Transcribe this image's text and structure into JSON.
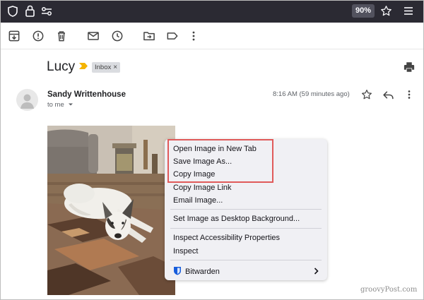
{
  "browser": {
    "zoom": "90%",
    "icons": [
      "shield-icon",
      "lock-icon",
      "permissions-icon",
      "star-icon",
      "hamburger-menu-icon"
    ]
  },
  "toolbar": {
    "icons": [
      "archive-icon",
      "report-spam-icon",
      "delete-icon",
      "mark-unread-icon",
      "snooze-icon",
      "move-to-icon",
      "label-icon",
      "more-vert-icon"
    ]
  },
  "email": {
    "subject": "Lucy",
    "label": "Inbox",
    "label_remove": "×",
    "sender": "Sandy Writtenhouse",
    "recipient": "to me",
    "timestamp": "8:16 AM (59 minutes ago)"
  },
  "context_menu": {
    "items": [
      "Open Image in New Tab",
      "Save Image As...",
      "Copy Image",
      "Copy Image Link",
      "Email Image...",
      "Set Image as Desktop Background...",
      "Inspect Accessibility Properties",
      "Inspect",
      "Bitwarden"
    ],
    "highlight_color": "#e05a5a"
  },
  "watermark": "groovyPost.com",
  "colors": {
    "chrome_bg": "#2b2a33",
    "menu_bg": "#f0f0f4",
    "bitwarden_blue": "#175ddc"
  }
}
